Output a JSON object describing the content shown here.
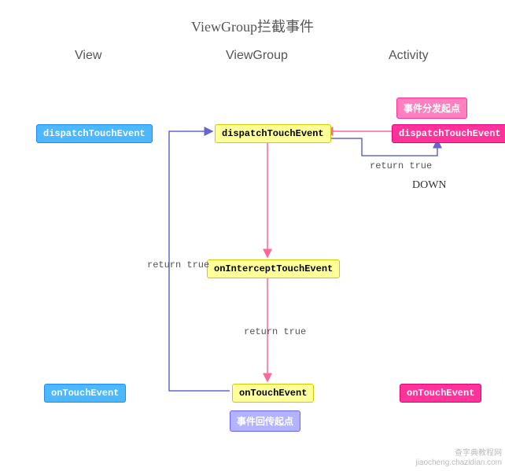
{
  "title": "ViewGroup拦截事件",
  "columns": {
    "view": "View",
    "viewgroup": "ViewGroup",
    "activity": "Activity"
  },
  "nodes": {
    "view_dispatch": "dispatchTouchEvent",
    "view_ontouch": "onTouchEvent",
    "vg_dispatch": "dispatchTouchEvent",
    "vg_intercept": "onInterceptTouchEvent",
    "vg_ontouch": "onTouchEvent",
    "act_start": "事件分发起点",
    "act_dispatch": "dispatchTouchEvent",
    "act_ontouch": "onTouchEvent",
    "vg_end": "事件回传起点"
  },
  "labels": {
    "return_true_top": "return true",
    "down": "DOWN",
    "return_true_left": "return true",
    "return_true_mid": "return true"
  },
  "watermark": {
    "l1": "查字典教程网",
    "l2": "jiaocheng.chazidian.com"
  }
}
